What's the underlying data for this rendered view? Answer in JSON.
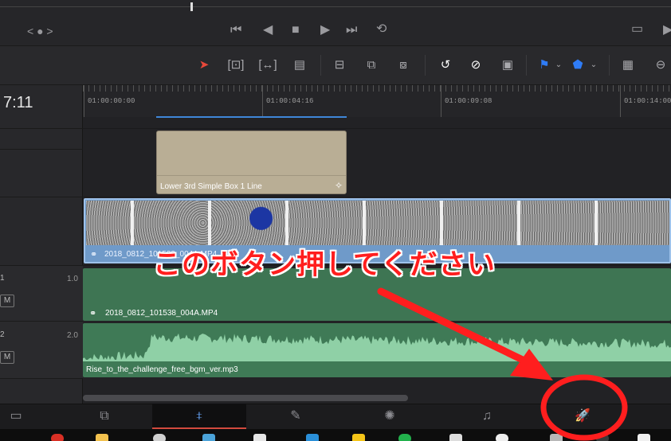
{
  "transport": {
    "nav_label": "< ● >",
    "icons": [
      "skip-back-icon",
      "play-reverse-icon",
      "stop-icon",
      "play-icon",
      "skip-forward-icon",
      "loop-icon"
    ]
  },
  "toolbar": {
    "icons": [
      "selection-arrow-icon",
      "trim-edit-icon",
      "dynamic-trim-icon",
      "blade-icon",
      "insert-clip-icon",
      "overwrite-clip-icon",
      "replace-clip-icon",
      "snapping-icon",
      "linked-selection-icon",
      "lock-icon",
      "flag-icon",
      "marker-icon",
      "timeline-view-icon",
      "zoom-out-icon"
    ],
    "accent_color": "#e8483a",
    "flag_color": "#2f7cf6"
  },
  "timecode": "7:11",
  "ruler": {
    "labels": [
      "01:00:00:00",
      "01:00:04:16",
      "01:00:09:08",
      "01:00:14:00"
    ]
  },
  "tracks": {
    "a1": {
      "short": "1",
      "level": "1.0",
      "mute": "M"
    },
    "a2": {
      "short": "2",
      "level": "2.0",
      "mute": "M"
    }
  },
  "clips": {
    "title": "Lower 3rd Simple Box 1 Line",
    "video": "2018_0812_101538_004A.MP4",
    "audio_linked": "2018_0812_101538_004A.MP4",
    "music": "Rise_to_the_challenge_free_bgm_ver.mp3"
  },
  "pages": [
    "media-page-icon",
    "cut-page-icon",
    "edit-page-icon",
    "fusion-page-icon",
    "color-page-icon",
    "fairlight-page-icon",
    "deliver-page-icon"
  ],
  "annotation": {
    "text": "このボタン押してください",
    "color": "#ff1e1e"
  }
}
